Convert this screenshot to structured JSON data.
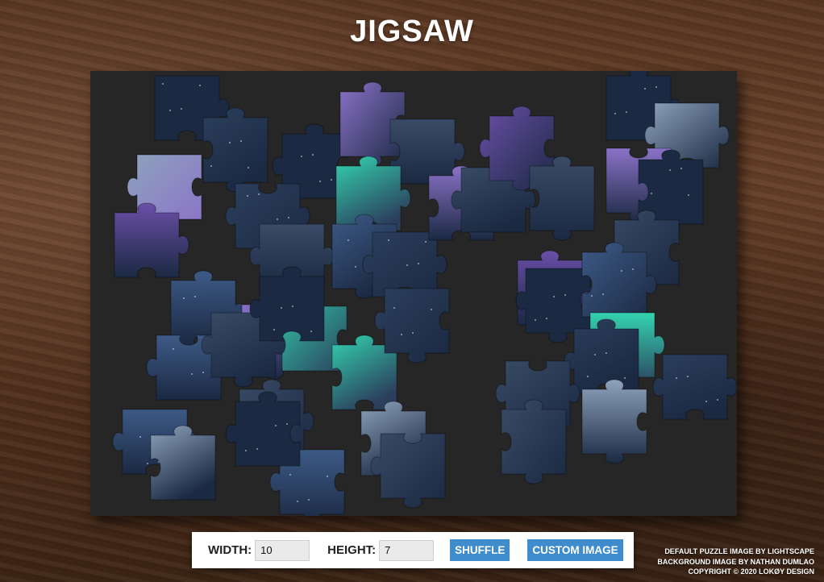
{
  "title": "JIGSAW",
  "controls": {
    "width_label": "WIDTH:",
    "width_value": "10",
    "height_label": "HEIGHT:",
    "height_value": "7",
    "shuffle_label": "SHUFFLE",
    "custom_image_label": "CUSTOM IMAGE"
  },
  "credits": {
    "line1": "DEFAULT PUZZLE IMAGE BY LIGHTSCAPE",
    "line2": "BACKGROUND IMAGE BY NATHAN DUMLAO",
    "line3": "COPYRIGHT © 2020 LOKØY DESIGN"
  },
  "puzzle": {
    "columns": 10,
    "rows": 7,
    "image_theme": "aurora night sky over snowy forest",
    "palette": {
      "navy": "#2b3f5c",
      "deep": "#1b2942",
      "blue": "#3d5a86",
      "violet": "#8a72c8",
      "purple": "#6a4fa8",
      "aurora": "#33d3b0",
      "snow": "#8ea3bd",
      "slate": "#394b66"
    }
  }
}
